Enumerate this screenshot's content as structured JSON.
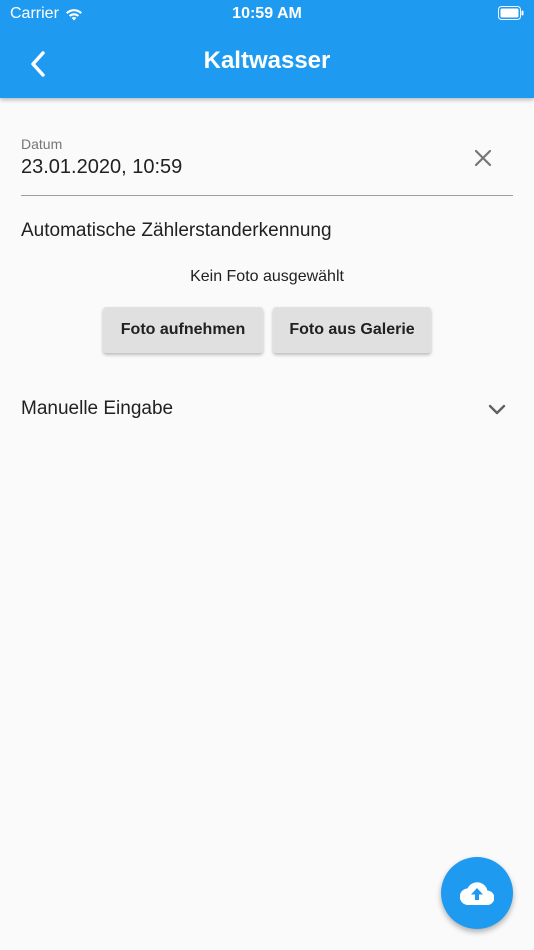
{
  "status_bar": {
    "carrier": "Carrier",
    "time": "10:59 AM",
    "icons": [
      "wifi-icon",
      "battery-icon"
    ]
  },
  "appbar": {
    "title": "Kaltwasser",
    "color": "#1e9bf0",
    "back_icon": "chevron-left-icon"
  },
  "date_field": {
    "label": "Datum",
    "value": "23.01.2020, 10:59",
    "clear_icon": "close-icon"
  },
  "auto_recognition": {
    "title": "Automatische Zählerstanderkennung",
    "status": "Kein Foto ausgewählt",
    "take_photo_label": "Foto aufnehmen",
    "gallery_label": "Foto aus Galerie"
  },
  "manual_entry": {
    "label": "Manuelle Eingabe",
    "expand_icon": "chevron-down-icon"
  },
  "fab": {
    "icon": "cloud-upload-icon",
    "color": "#1e9bf0"
  }
}
